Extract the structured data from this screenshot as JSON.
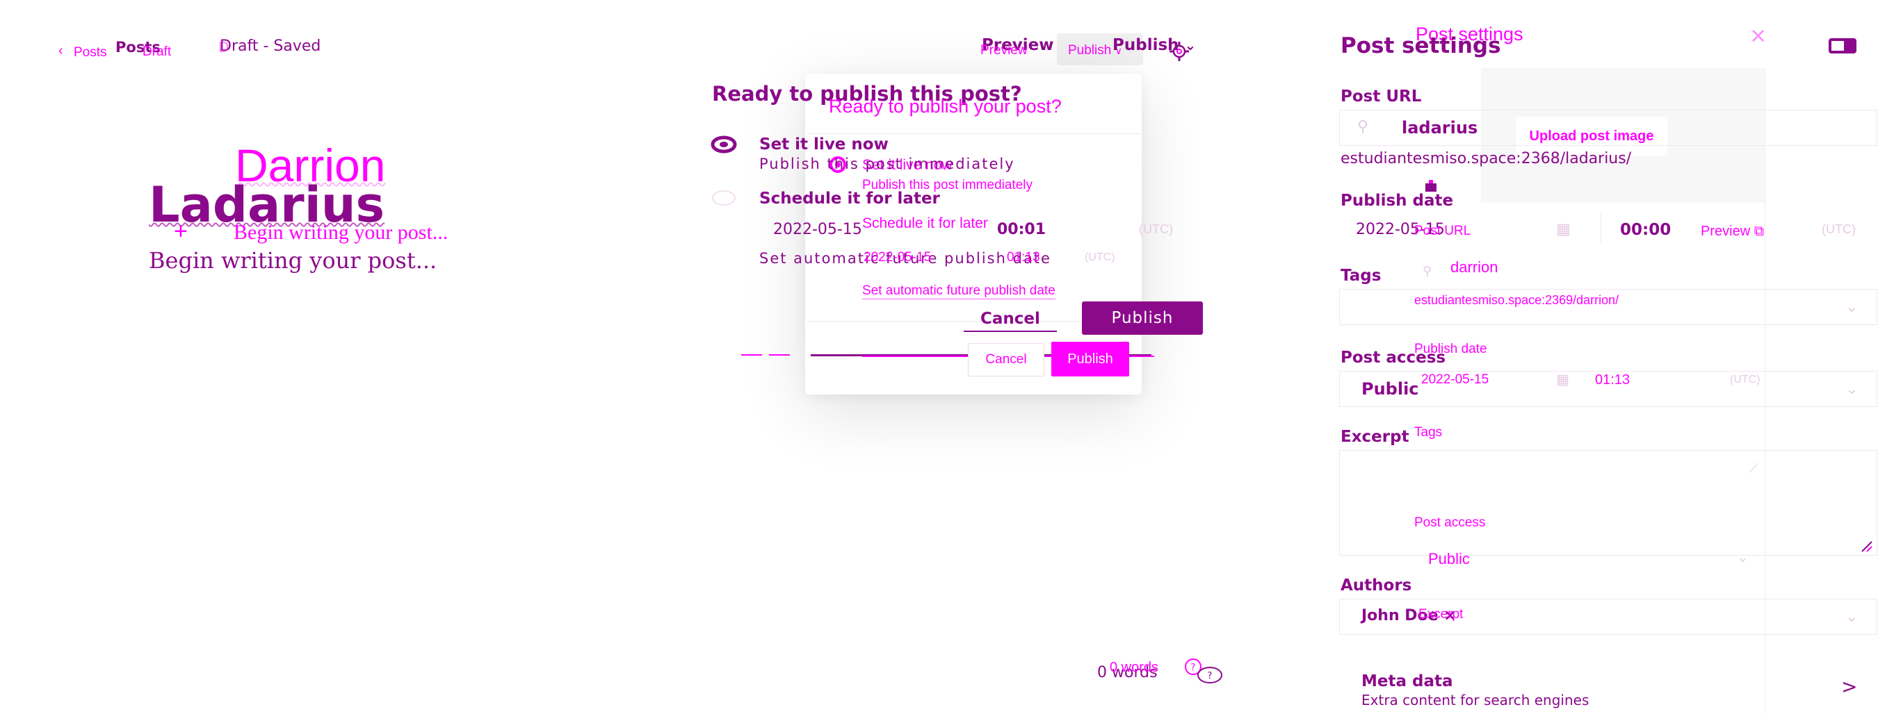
{
  "editor": {
    "back_arrow": "‹",
    "posts_label": "Posts",
    "posts_label_alt": "Posts",
    "draft_label": "Draft",
    "status": "Draft - Saved",
    "preview_label": "Preview",
    "preview_label_alt": "Preview",
    "publish_label": "Publish",
    "publish_label_alt": "Publish",
    "title_primary": "Ladarius",
    "title_secondary": "Darrion",
    "body_placeholder": "Begin writing your post...",
    "body_placeholder_alt": "Begin writing your post...",
    "add_symbol": "+",
    "word_count": "0 words",
    "word_count_alt": "0 words"
  },
  "publish_menu": {
    "heading": "Ready to publish this post?",
    "heading_alt": "Ready to publish your post?",
    "option_now": "Set it live now",
    "option_now_alt": "Set it live now",
    "option_now_desc": "Publish this post immediately",
    "option_now_desc_alt": "Publish this post immediately",
    "option_later": "Schedule it for later",
    "option_later_alt": "Schedule it for later",
    "schedule_date": "2022-05-15",
    "schedule_date_alt": "2022-05-15",
    "schedule_time": "00:01",
    "schedule_time_alt": "01:13",
    "timezone": "(UTC)",
    "timezone_alt": "(UTC)",
    "future_hint": "Set automatic future publish date",
    "future_hint_alt": "Set automatic future publish date",
    "cancel_label": "Cancel",
    "cancel_label_alt": "Cancel",
    "publish_button": "Publish",
    "publish_button_alt": "Publish"
  },
  "settings": {
    "title": "Post settings",
    "title_alt": "Post settings",
    "close_symbol": "×",
    "upload_image": "Upload post image",
    "post_url_label": "Post URL",
    "post_url_label_alt": "Post URL",
    "slug": "ladarius",
    "slug_alt": "darrion",
    "full_url": "estudiantesmiso.space:2368/ladarius/",
    "full_url_alt": "estudiantesmiso.space:2369/darrion/",
    "publish_date_label": "Publish date",
    "publish_date_label_alt": "Publish date",
    "date": "2022-05-15",
    "date_alt": "2022-05-15",
    "time": "00:00",
    "time_alt": "01:13",
    "timezone": "(UTC)",
    "timezone_alt": "(UTC)",
    "preview_link": "Preview",
    "tags_label": "Tags",
    "tags_label_alt": "Tags",
    "access_label": "Post access",
    "access_label_alt": "Post access",
    "access_value": "Public",
    "access_value_alt": "Public",
    "excerpt_label": "Excerpt",
    "excerpt_label_alt": "Excerpt",
    "authors_label": "Authors",
    "author_name": "John Doe",
    "remove_symbol": "×",
    "meta_title": "Meta data",
    "meta_desc": "Extra content for search engines",
    "meta_arrow": ">"
  },
  "colors": {
    "primary": "#8b0a8b",
    "secondary": "#ff00ff",
    "background": "#ffffff"
  }
}
